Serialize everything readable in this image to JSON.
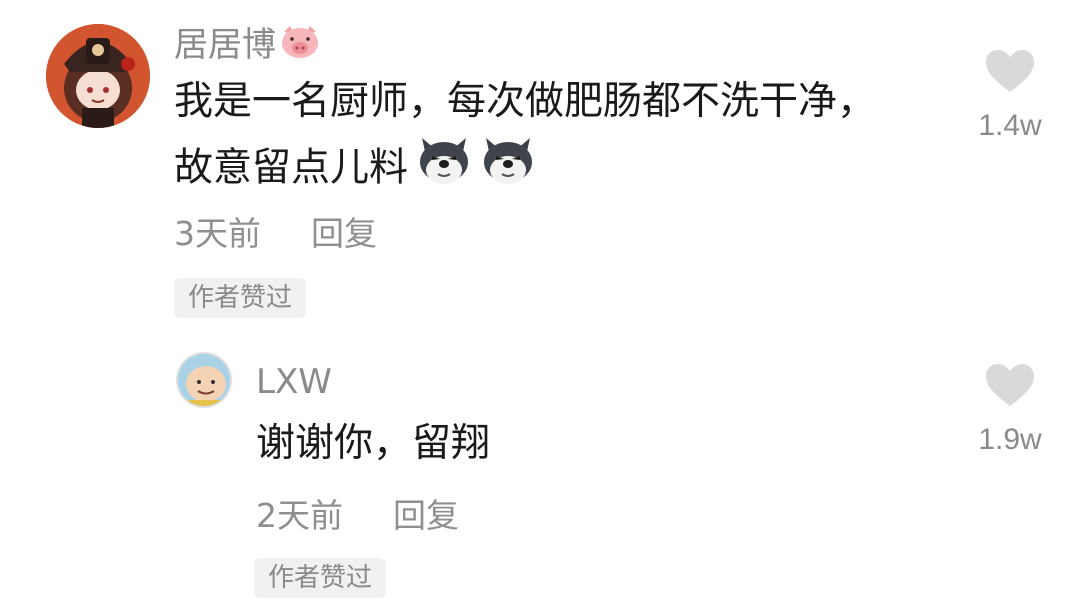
{
  "comment": {
    "username": "居居博",
    "username_emoji": "pig-face-icon",
    "text": "我是一名厨师，每次做肥肠都不洗干净，故意留点儿料",
    "inline_emojis": [
      "dog-face-icon",
      "dog-face-icon"
    ],
    "time": "3天前",
    "reply_label": "回复",
    "badge": "作者赞过",
    "like_count": "1.4w"
  },
  "reply": {
    "username": "LXW",
    "text": "谢谢你，留翔",
    "time": "2天前",
    "reply_label": "回复",
    "badge": "作者赞过",
    "like_count": "1.9w"
  },
  "colors": {
    "username": "#8a8a8a",
    "text": "#1a1a1a",
    "meta": "#8f8f8f",
    "badge_bg": "#f1f1f1",
    "heart": "#d9d9d9"
  }
}
